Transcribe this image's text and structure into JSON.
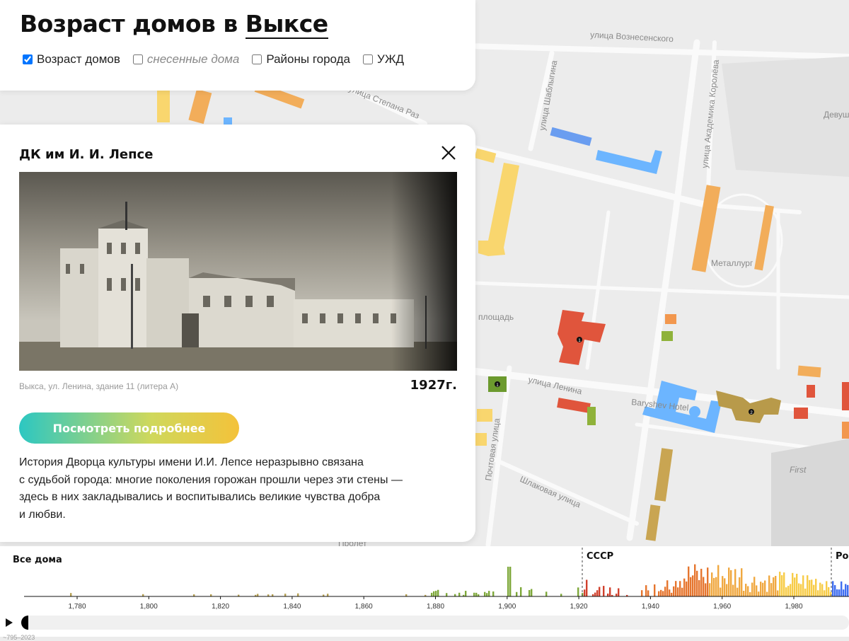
{
  "header": {
    "title_prefix": "Возраст домов в",
    "title_city": "Выксе",
    "layers": [
      {
        "label": "Возраст домов",
        "checked": true
      },
      {
        "label": "снесенные дома",
        "checked": false
      },
      {
        "label": "Районы города",
        "checked": false
      },
      {
        "label": "УЖД",
        "checked": false
      }
    ]
  },
  "info": {
    "name": "ДК им И. И. Лепсе",
    "photo_icon": "historic-building-photo",
    "address": "Выкса, ул. Ленина, здание 11 (литера А)",
    "year": "1927г.",
    "more_button": "Посмотреть подробнее",
    "description_lines": [
      "История Дворца культуры имени И.И. Лепсе неразрывно связана",
      "с судьбой города: многие поколения горожан прошли через эти стены —",
      "здесь в них закладывались и воспитывались великие чувства добра",
      "и любви."
    ]
  },
  "map": {
    "street_labels": [
      "улица Вознесенского",
      "улица Шаблыгина",
      "улица Академика Королёва",
      "улица Степана Раз",
      "Девуш",
      "Металлург",
      "площадь",
      "улица Ленина",
      "Baryshev Hotel",
      "Почтовая улица",
      "Шлаковая улица",
      "First",
      "Пролет"
    ],
    "marker_numbers": [
      "1",
      "1",
      "2"
    ]
  },
  "timeline": {
    "all_label": "Все дома",
    "eras": [
      "СССР",
      "Ро"
    ],
    "ticks": [
      "1,780",
      "1,800",
      "1,820",
      "1,840",
      "1,860",
      "1,880",
      "1,900",
      "1,920",
      "1,940",
      "1,960",
      "1,980"
    ],
    "range_label": "~795–2023",
    "play_icon": "play-icon"
  }
}
